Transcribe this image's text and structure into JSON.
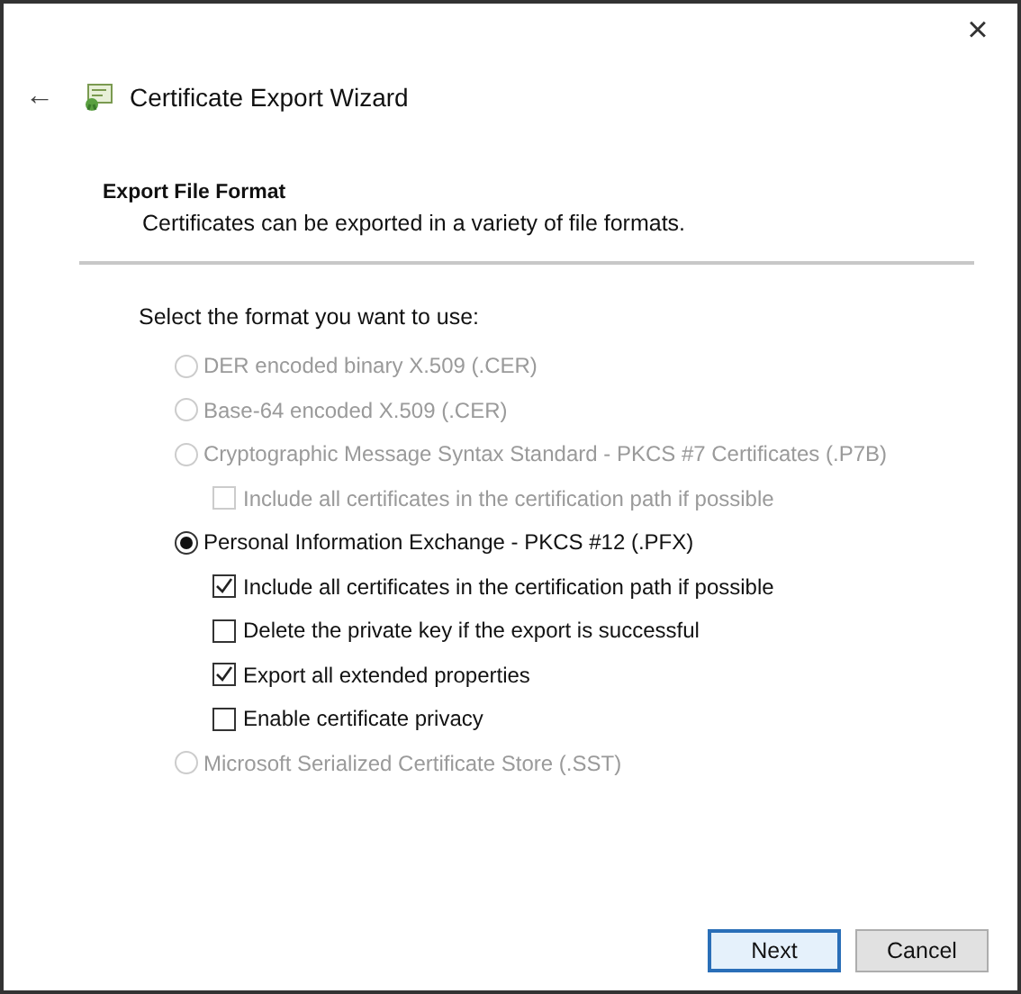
{
  "window": {
    "title": "Certificate Export Wizard",
    "close": "×",
    "back": "←"
  },
  "header": {
    "title": "Export File Format",
    "subtitle": "Certificates can be exported in a variety of file formats."
  },
  "prompt": "Select the format you want to use:",
  "options": [
    {
      "kind": "radio",
      "label": "DER encoded binary X.509 (.CER)",
      "selected": false,
      "disabled": true
    },
    {
      "kind": "radio",
      "label": "Base-64 encoded X.509 (.CER)",
      "selected": false,
      "disabled": true
    },
    {
      "kind": "radio",
      "label": "Cryptographic Message Syntax Standard - PKCS #7 Certificates (.P7B)",
      "selected": false,
      "disabled": true,
      "children": [
        {
          "kind": "checkbox",
          "label": "Include all certificates in the certification path if possible",
          "checked": false,
          "disabled": true
        }
      ]
    },
    {
      "kind": "radio",
      "label": "Personal Information Exchange - PKCS #12 (.PFX)",
      "selected": true,
      "disabled": false,
      "children": [
        {
          "kind": "checkbox",
          "label": "Include all certificates in the certification path if possible",
          "checked": true,
          "disabled": false
        },
        {
          "kind": "checkbox",
          "label": "Delete the private key if the export is successful",
          "checked": false,
          "disabled": false
        },
        {
          "kind": "checkbox",
          "label": "Export all extended properties",
          "checked": true,
          "disabled": false
        },
        {
          "kind": "checkbox",
          "label": "Enable certificate privacy",
          "checked": false,
          "disabled": false
        }
      ]
    },
    {
      "kind": "radio",
      "label": "Microsoft Serialized Certificate Store (.SST)",
      "selected": false,
      "disabled": true
    }
  ],
  "buttons": [
    {
      "label": "Next",
      "default": true
    },
    {
      "label": "Cancel",
      "default": false
    }
  ]
}
